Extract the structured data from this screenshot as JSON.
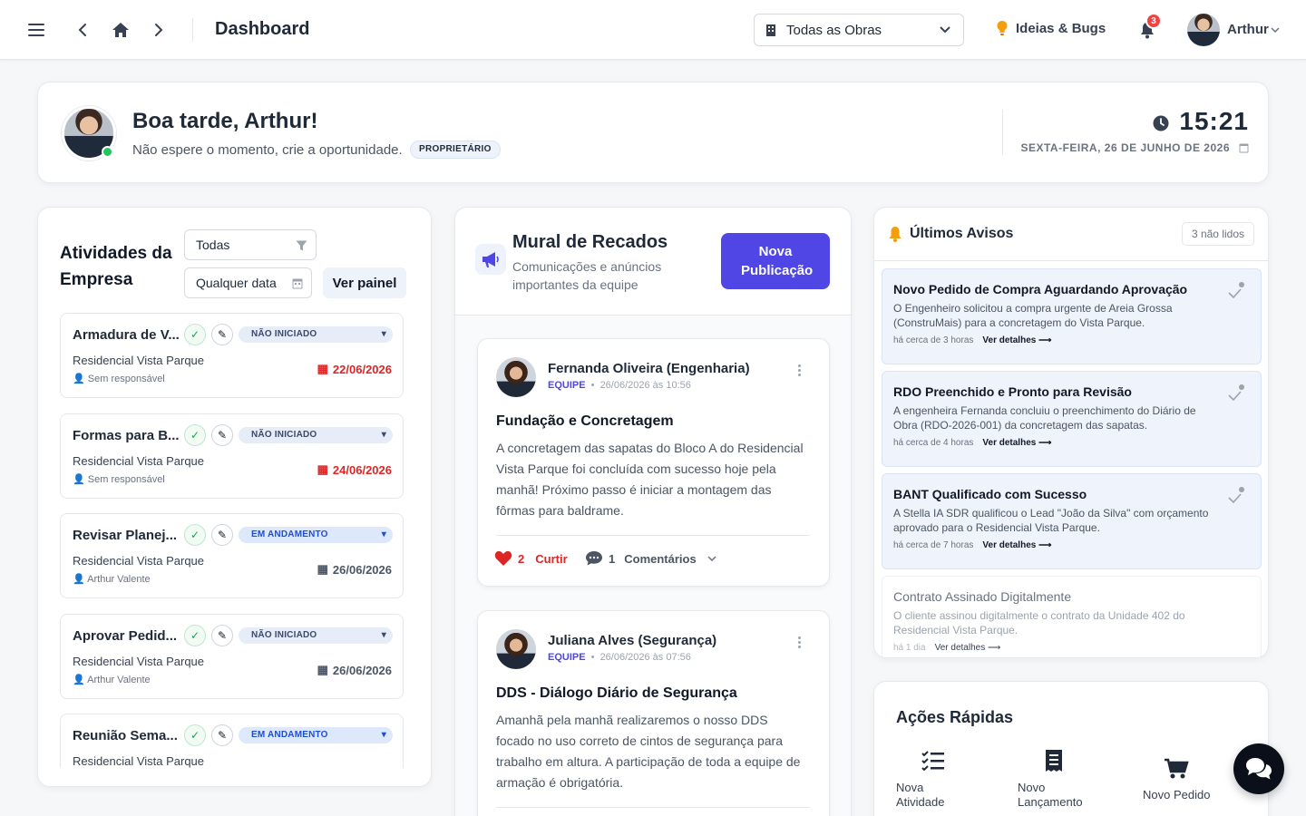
{
  "header": {
    "title": "Dashboard",
    "obra_select": "Todas as Obras",
    "ideias": "Ideias & Bugs",
    "notif_count": "3",
    "user": "Arthur"
  },
  "welcome": {
    "greeting": "Boa tarde, Arthur!",
    "subtitle": "Não espere o momento, crie a oportunidade.",
    "role": "PROPRIETÁRIO",
    "time": "15:21",
    "date": "SEXTA-FEIRA, 26 DE JUNHO DE 2026"
  },
  "activities": {
    "title": "Atividades da Empresa",
    "filter": "Todas",
    "date_filter": "Qualquer data",
    "view_button": "Ver painel",
    "tasks": [
      {
        "title": "Armadura de V...",
        "status": "NÃO INICIADO",
        "project": "Residencial Vista Parque",
        "responsible": "Sem responsável",
        "date": "22/06/2026"
      },
      {
        "title": "Formas para B...",
        "status": "NÃO INICIADO",
        "project": "Residencial Vista Parque",
        "responsible": "Sem responsável",
        "date": "24/06/2026"
      },
      {
        "title": "Revisar Planej...",
        "status": "EM ANDAMENTO",
        "project": "Residencial Vista Parque",
        "responsible": "Arthur Valente",
        "date": "26/06/2026"
      },
      {
        "title": "Aprovar Pedid...",
        "status": "NÃO INICIADO",
        "project": "Residencial Vista Parque",
        "responsible": "Arthur Valente",
        "date": "26/06/2026"
      },
      {
        "title": "Reunião Sema...",
        "status": "EM ANDAMENTO",
        "project": "Residencial Vista Parque",
        "responsible": "",
        "date": ""
      }
    ]
  },
  "mural": {
    "title": "Mural de Recados",
    "subtitle": "Comunicações e anúncios importantes da equipe",
    "new_button": "Nova Publicação",
    "posts": [
      {
        "author": "Fernanda Oliveira (Engenharia)",
        "tag": "EQUIPE",
        "datetime": "26/06/2026 às 10:56",
        "title": "Fundação e Concretagem",
        "body": "A concretagem das sapatas do Bloco A do Residencial Vista Parque foi concluída com sucesso hoje pela manhã! Próximo passo é iniciar a montagem das fôrmas para baldrame.",
        "likes": "2",
        "like_label": "Curtir",
        "comments": "1",
        "comments_label": "Comentários"
      },
      {
        "author": "Juliana Alves (Segurança)",
        "tag": "EQUIPE",
        "datetime": "26/06/2026 às 07:56",
        "title": "DDS - Diálogo Diário de Segurança",
        "body": "Amanhã pela manhã realizaremos o nosso DDS focado no uso correto de cintos de segurança para trabalho em altura. A participação de toda a equipe de armação é obrigatória."
      }
    ]
  },
  "avisos": {
    "title": "Últimos Avisos",
    "unread": "3 não lidos",
    "details_label": "Ver detalhes ⟶",
    "items": [
      {
        "title": "Novo Pedido de Compra Aguardando Aprovação",
        "body": "O Engenheiro solicitou a compra urgente de Areia Grossa (ConstruMais) para a concretagem do Vista Parque.",
        "time": "há cerca de 3 horas"
      },
      {
        "title": "RDO Preenchido e Pronto para Revisão",
        "body": "A engenheira Fernanda concluiu o preenchimento do Diário de Obra (RDO-2026-001) da concretagem das sapatas.",
        "time": "há cerca de 4 horas"
      },
      {
        "title": "BANT Qualificado com Sucesso",
        "body": "A Stella IA SDR qualificou o Lead \"João da Silva\" com orçamento aprovado para o Residencial Vista Parque.",
        "time": "há cerca de 7 horas"
      },
      {
        "title": "Contrato Assinado Digitalmente",
        "body": "O cliente assinou digitalmente o contrato da Unidade 402 do Residencial Vista Parque.",
        "time": "há 1 dia"
      }
    ]
  },
  "quick": {
    "title": "Ações Rápidas",
    "actions": [
      {
        "label": "Nova Atividade"
      },
      {
        "label": "Novo Lançamento"
      },
      {
        "label": "Novo Pedido"
      }
    ]
  },
  "colors": {
    "primary": "#4f46e5",
    "danger": "#dc2626",
    "success": "#16a34a"
  }
}
